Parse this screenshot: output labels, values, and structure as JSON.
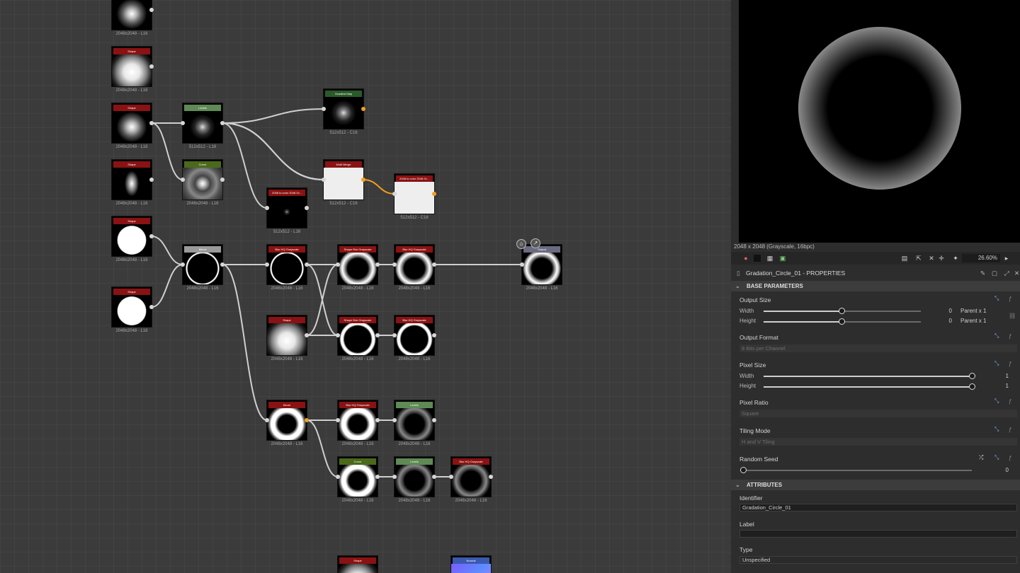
{
  "graph": {
    "nodes": [
      {
        "id": "n1",
        "title": "",
        "size": "2048x2048 - L16",
        "head": "#8a1212",
        "thumb": "blob"
      },
      {
        "id": "n2",
        "title": "Shape",
        "size": "2048x2048 - L16",
        "head": "#8a1212",
        "thumb": "bigblob"
      },
      {
        "id": "n3",
        "title": "Shape",
        "size": "2048x2048 - L16",
        "head": "#8a1212",
        "thumb": "blob"
      },
      {
        "id": "n4",
        "title": "Levels",
        "size": "512x512 - L16",
        "head": "#5f8a55",
        "thumb": "smallblob"
      },
      {
        "id": "n5",
        "title": "Gradient Map",
        "size": "512x512 - C16",
        "head": "#2a5a2a",
        "thumb": "smallblob"
      },
      {
        "id": "n6",
        "title": "Shape",
        "size": "2048x2048 - L16",
        "head": "#8a1212",
        "thumb": "oval"
      },
      {
        "id": "n7",
        "title": "Curve",
        "size": "2048x2048 - L16",
        "head": "#4a6a1a",
        "thumb": "glowring"
      },
      {
        "id": "n8",
        "title": "Multi Merge",
        "size": "512x512 - C16",
        "head": "#8a1212",
        "thumb": "white"
      },
      {
        "id": "n9",
        "title": "2048 to color 2048 Gr...",
        "size": "512x512 - C16",
        "head": "#8a1212",
        "thumb": "white"
      },
      {
        "id": "n10",
        "title": "2048 to color 2048 Gr...",
        "size": "512x512 - L16",
        "head": "#8a1212",
        "thumb": "dot"
      },
      {
        "id": "n11",
        "title": "Shape",
        "size": "2048x2048 - L16",
        "head": "#8a1212",
        "thumb": "disc"
      },
      {
        "id": "n12",
        "title": "Shape",
        "size": "2048x2048 - L16",
        "head": "#8a1212",
        "thumb": "disc"
      },
      {
        "id": "n13",
        "title": "Blend",
        "size": "2048x2048 - L16",
        "head": "#9a9a9a",
        "thumb": "thinring"
      },
      {
        "id": "n14",
        "title": "Blur HQ Grayscale",
        "size": "2048x2048 - L16",
        "head": "#8a1212",
        "thumb": "thinring"
      },
      {
        "id": "n15",
        "title": "Shape Blur Grayscale",
        "size": "2048x2048 - L16",
        "head": "#8a1212",
        "thumb": "ring"
      },
      {
        "id": "n16",
        "title": "Blur HQ Grayscale",
        "size": "2048x2048 - L16",
        "head": "#8a1212",
        "thumb": "ring"
      },
      {
        "id": "n17",
        "title": "Output",
        "size": "2048x2048 - L16",
        "head": "#6a6a80",
        "thumb": "ring"
      },
      {
        "id": "n18",
        "title": "Shape",
        "size": "2048x2048 - L16",
        "head": "#8a1212",
        "thumb": "bigblob"
      },
      {
        "id": "n19",
        "title": "Shape Blur Grayscale",
        "size": "2048x2048 - L16",
        "head": "#8a1212",
        "thumb": "boldring"
      },
      {
        "id": "n20",
        "title": "Blur HQ Grayscale",
        "size": "2048x2048 - L16",
        "head": "#8a1212",
        "thumb": "boldring"
      },
      {
        "id": "n21",
        "title": "Bevel",
        "size": "2048x2048 - L16",
        "head": "#8a1212",
        "thumb": "thickring"
      },
      {
        "id": "n22",
        "title": "Blur HQ Grayscale",
        "size": "2048x2048 - L16",
        "head": "#8a1212",
        "thumb": "thickring"
      },
      {
        "id": "n23",
        "title": "Levels",
        "size": "2048x2048 - L16",
        "head": "#5f8a55",
        "thumb": "darkring"
      },
      {
        "id": "n24",
        "title": "Curve",
        "size": "2048x2048 - L16",
        "head": "#4a6a1a",
        "thumb": "thickring"
      },
      {
        "id": "n25",
        "title": "Levels",
        "size": "2048x2048 - L16",
        "head": "#5f8a55",
        "thumb": "darkring"
      },
      {
        "id": "n26",
        "title": "Blur HQ Grayscale",
        "size": "2048x2048 - L16",
        "head": "#8a1212",
        "thumb": "darkring"
      },
      {
        "id": "n27",
        "title": "Shape",
        "size": "",
        "head": "#8a1212",
        "thumb": "bigblob"
      },
      {
        "id": "n28",
        "title": "Normal",
        "size": "",
        "head": "#3a5ab0",
        "thumb": "normal"
      }
    ]
  },
  "preview": {
    "info": "2048 x 2048 (Grayscale, 16bpc)",
    "zoom": "26.60%"
  },
  "properties": {
    "title": "Gradation_Circle_01 - PROPERTIES",
    "base_section": "BASE PARAMETERS",
    "output_size": {
      "label": "Output Size",
      "width_label": "Width",
      "height_label": "Height",
      "width_value": "0",
      "height_value": "0",
      "width_suffix": "Parent x 1",
      "height_suffix": "Parent x 1"
    },
    "output_format": {
      "label": "Output Format",
      "value": "8 Bits per Channel"
    },
    "pixel_size": {
      "label": "Pixel Size",
      "width_label": "Width",
      "height_label": "Height",
      "width_value": "1",
      "height_value": "1"
    },
    "pixel_ratio": {
      "label": "Pixel Ratio",
      "value": "Square"
    },
    "tiling_mode": {
      "label": "Tiling Mode",
      "value": "H and V Tiling"
    },
    "random_seed": {
      "label": "Random Seed",
      "value": "0"
    },
    "attributes_section": "ATTRIBUTES",
    "identifier": {
      "label": "Identifier",
      "value": "Gradation_Circle_01"
    },
    "label_field": {
      "label": "Label",
      "value": ""
    },
    "type": {
      "label": "Type",
      "value": "Unspecified"
    }
  }
}
